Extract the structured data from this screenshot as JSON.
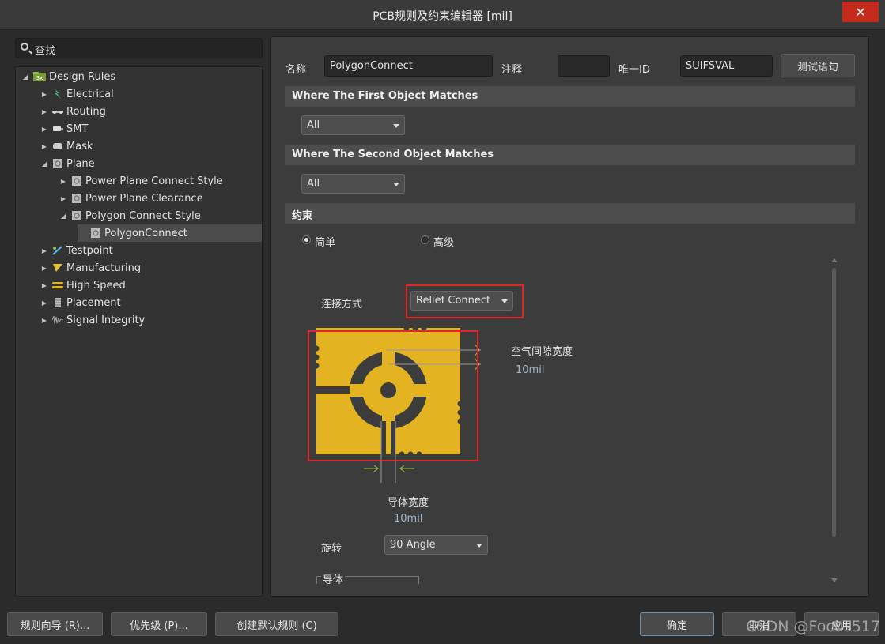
{
  "window": {
    "title": "PCB规则及约束编辑器 [mil]",
    "close_glyph": "✕"
  },
  "search": {
    "text": "查找"
  },
  "tree": {
    "root": "Design Rules",
    "items": [
      {
        "label": "Electrical",
        "toggle": "▶"
      },
      {
        "label": "Routing",
        "toggle": "▶"
      },
      {
        "label": "SMT",
        "toggle": "▶"
      },
      {
        "label": "Mask",
        "toggle": "▶"
      },
      {
        "label": "Plane",
        "toggle": "◢"
      },
      {
        "label": "Power Plane Connect Style",
        "toggle": "▶"
      },
      {
        "label": "Power Plane Clearance",
        "toggle": "▶"
      },
      {
        "label": "Polygon Connect Style",
        "toggle": "◢"
      },
      {
        "label": "PolygonConnect",
        "toggle": ""
      },
      {
        "label": "Testpoint",
        "toggle": "▶"
      },
      {
        "label": "Manufacturing",
        "toggle": "▶"
      },
      {
        "label": "High Speed",
        "toggle": "▶"
      },
      {
        "label": "Placement",
        "toggle": "▶"
      },
      {
        "label": "Signal Integrity",
        "toggle": "▶"
      }
    ],
    "root_toggle": "◢"
  },
  "rule": {
    "name_label": "名称",
    "name_value": "PolygonConnect",
    "comment_label": "注释",
    "comment_value": "",
    "uid_label": "唯一ID",
    "uid_value": "SUIFSVAL",
    "test_button": "测试语句"
  },
  "first_match": {
    "header": "Where The First Object Matches",
    "value": "All"
  },
  "second_match": {
    "header": "Where The Second Object Matches",
    "value": "All"
  },
  "constraints": {
    "header": "约束",
    "mode_simple": "简单",
    "mode_advanced": "高级",
    "connect_label": "连接方式",
    "connect_value": "Relief Connect",
    "air_gap_label": "空气间隙宽度",
    "air_gap_value": "10mil",
    "conductor_width_label": "导体宽度",
    "conductor_width_value": "10mil",
    "rotation_label": "旋转",
    "rotation_value": "90 Angle",
    "conductors_label": "导体"
  },
  "footer": {
    "wizard": "规则向导 (R)...",
    "priority": "优先级 (P)...",
    "default_rules": "创建默认规则 (C)",
    "ok": "确定",
    "cancel": "取消",
    "apply": "应用"
  },
  "watermark": "CSDN @Focus517",
  "colors": {
    "copper": "#e3b322",
    "highlight_box": "#e0252b",
    "close": "#c42b1c"
  }
}
